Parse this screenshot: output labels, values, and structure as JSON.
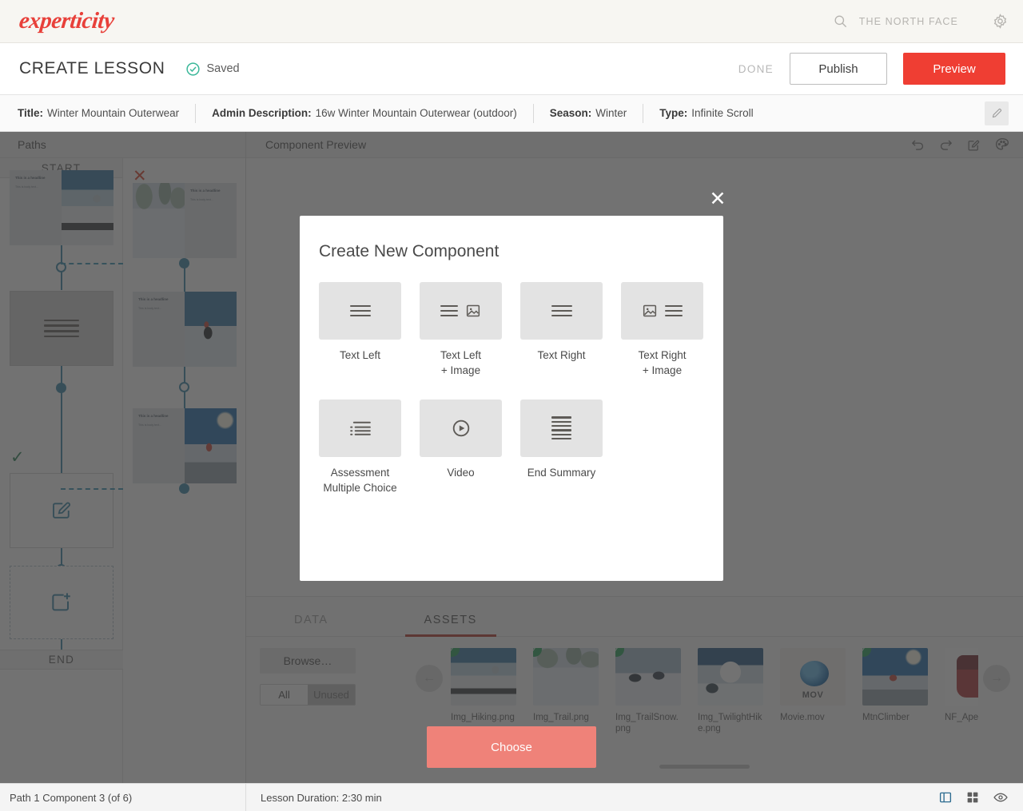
{
  "brand": {
    "logo_text": "experticity",
    "logo_color": "#e8403a",
    "account_name": "THE NORTH FACE",
    "search_icon": "search-icon",
    "settings_icon": "gear-icon"
  },
  "action_bar": {
    "page_title": "CREATE LESSON",
    "saved_label": "Saved",
    "saved_icon": "check-circle-icon",
    "saved_color": "#3cb89a",
    "done_label": "DONE",
    "publish_label": "Publish",
    "preview_label": "Preview",
    "preview_color": "#ef3e33"
  },
  "meta": {
    "fields": [
      {
        "key": "Title:",
        "value": "Winter Mountain Outerwear"
      },
      {
        "key": "Admin Description:",
        "value": "16w Winter Mountain Outerwear (outdoor)"
      },
      {
        "key": "Season:",
        "value": "Winter"
      },
      {
        "key": "Type:",
        "value": "Infinite Scroll"
      }
    ],
    "edit_icon": "pencil-icon"
  },
  "paths": {
    "header": "Paths",
    "start_label": "START",
    "end_label": "END",
    "error_mark": "✕",
    "ok_mark": "✓"
  },
  "editor": {
    "header": "Component Preview",
    "tools": [
      {
        "name": "undo-icon"
      },
      {
        "name": "redo-icon"
      },
      {
        "name": "edit-icon"
      },
      {
        "name": "palette-icon"
      }
    ]
  },
  "assets": {
    "tabs": [
      {
        "label": "DATA",
        "active": false
      },
      {
        "label": "ASSETS",
        "active": true
      }
    ],
    "active_tab_color": "#b32b22",
    "browse_label": "Browse…",
    "filter": {
      "all_label": "All",
      "unused_label": "Unused",
      "selected": "Unused"
    },
    "prev_arrow": "←",
    "next_arrow": "→",
    "items": [
      {
        "name": "Img_Hiking.png",
        "selected": true,
        "kind": "image"
      },
      {
        "name": "Img_Trail.png",
        "selected": true,
        "kind": "image"
      },
      {
        "name": "Img_TrailSnow.png",
        "selected": true,
        "kind": "image"
      },
      {
        "name": "Img_TwilightHike.png",
        "selected": false,
        "kind": "image"
      },
      {
        "name": "Movie.mov",
        "selected": false,
        "kind": "video",
        "badge": "MOV"
      },
      {
        "name": "MtnClimber",
        "selected": true,
        "kind": "image"
      },
      {
        "name": "NF_ApexJacket",
        "selected": false,
        "kind": "image"
      }
    ]
  },
  "status": {
    "component_position": "Path 1 Component 3 (of 6)",
    "lesson_duration": "Lesson Duration: 2:30 min",
    "icons": [
      {
        "name": "split-panel-icon",
        "active": true
      },
      {
        "name": "grid-view-icon",
        "active": false
      },
      {
        "name": "eye-preview-icon",
        "active": false
      }
    ]
  },
  "modal": {
    "title": "Create New Component",
    "close_label": "✕",
    "choose_label": "Choose",
    "choose_color": "#ef8279",
    "options": [
      {
        "label": "Text Left",
        "icon": "text-lines-icon"
      },
      {
        "label": "Text Left\n+ Image",
        "icon": "text-lines-image-icon"
      },
      {
        "label": "Text Right",
        "icon": "text-lines-icon"
      },
      {
        "label": "Text Right\n+ Image",
        "icon": "image-text-lines-icon"
      },
      {
        "label": "Assessment\nMultiple Choice",
        "icon": "bullet-list-icon"
      },
      {
        "label": "Video",
        "icon": "play-circle-icon"
      },
      {
        "label": "End Summary",
        "icon": "paragraph-lines-icon"
      }
    ]
  },
  "node_cards": {
    "headline": "This is a headline",
    "body": "This is body text…"
  }
}
